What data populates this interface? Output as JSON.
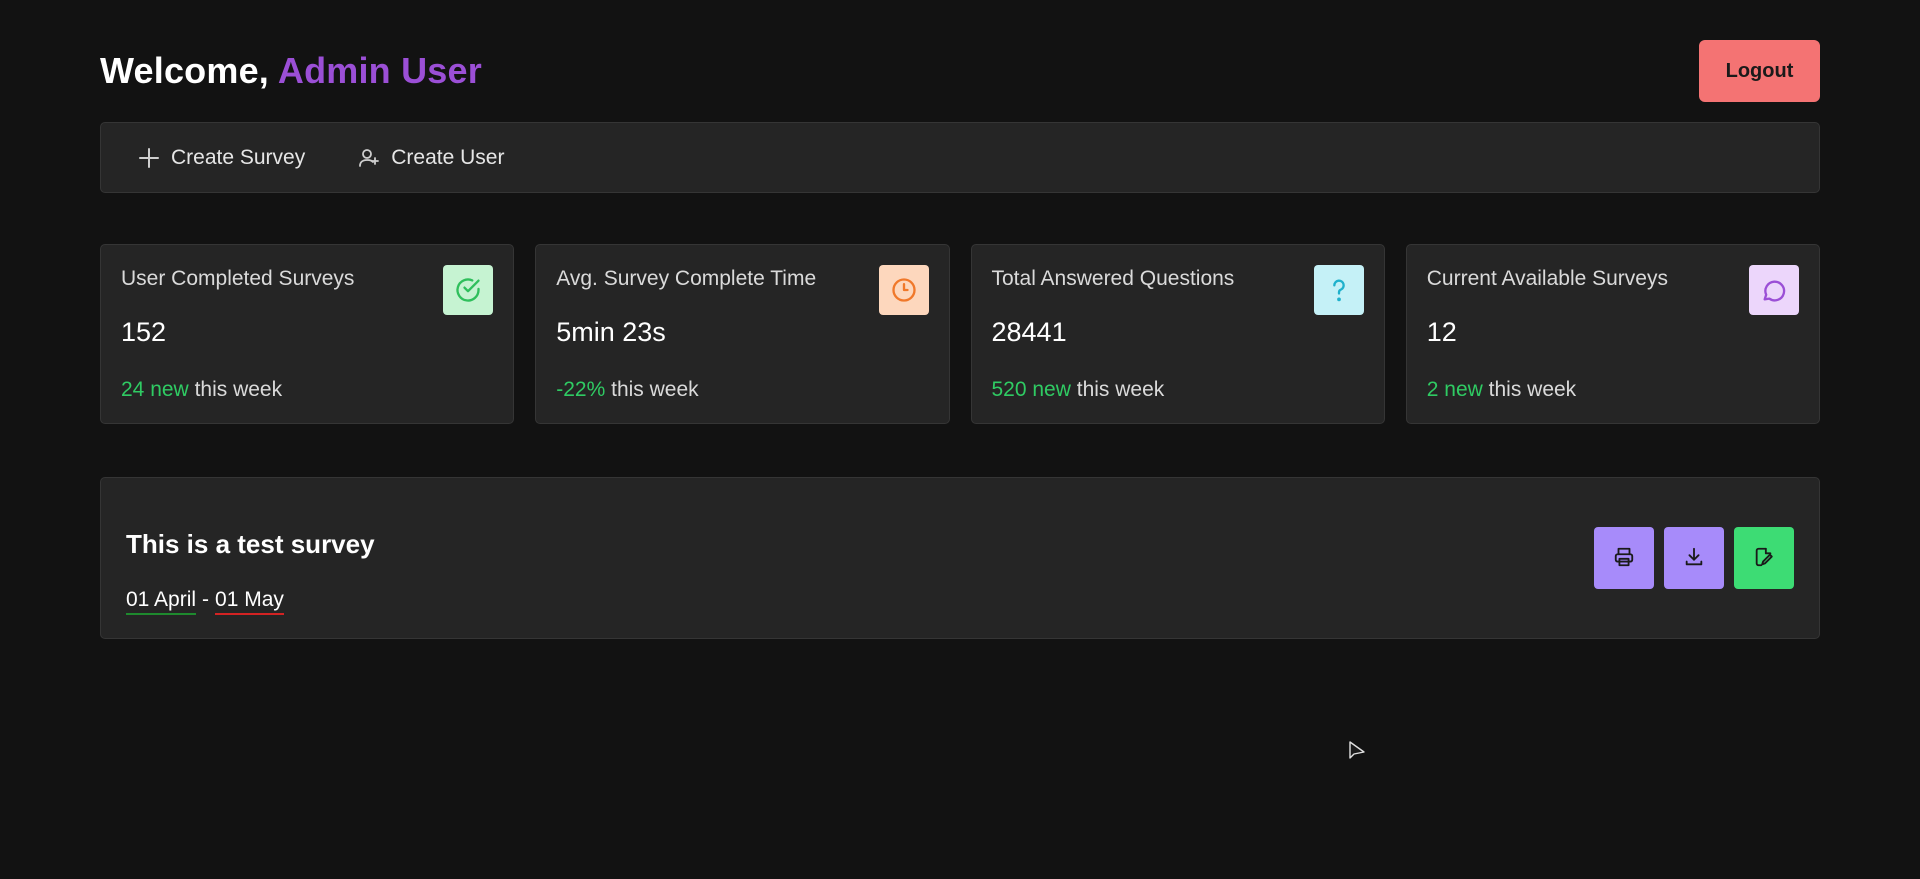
{
  "header": {
    "welcome_prefix": "Welcome,",
    "user_name": "Admin User",
    "logout_label": "Logout"
  },
  "actions": [
    {
      "label": "Create Survey",
      "icon": "plus-icon"
    },
    {
      "label": "Create User",
      "icon": "user-plus-icon"
    }
  ],
  "stats": [
    {
      "title": "User Completed Surveys",
      "value": "152",
      "delta": "24 new",
      "suffix": "this week",
      "icon": "check-circle-icon",
      "icon_bg": "#c6f3d2",
      "icon_color": "#2fbf5c"
    },
    {
      "title": "Avg. Survey Complete Time",
      "value": "5min 23s",
      "delta": "-22%",
      "suffix": "this week",
      "icon": "clock-icon",
      "icon_bg": "#fdd7bd",
      "icon_color": "#f0782a"
    },
    {
      "title": "Total Answered Questions",
      "value": "28441",
      "delta": "520 new",
      "suffix": "this week",
      "icon": "question-icon",
      "icon_bg": "#c5f1f7",
      "icon_color": "#1fb1cc"
    },
    {
      "title": "Current Available Surveys",
      "value": "12",
      "delta": "2 new",
      "suffix": "this week",
      "icon": "chat-bubble-icon",
      "icon_bg": "#ecd6fb",
      "icon_color": "#9b4fd6"
    }
  ],
  "survey": {
    "title": "This is a test survey",
    "start_date": "01 April",
    "separator": "-",
    "end_date": "01 May",
    "buttons": [
      {
        "icon": "printer-icon",
        "color": "#a78bfa"
      },
      {
        "icon": "download-icon",
        "color": "#a78bfa"
      },
      {
        "icon": "edit-icon",
        "color": "#3ddc74"
      }
    ]
  },
  "colors": {
    "background": "#121212",
    "panel": "#252525",
    "accent_purple": "#9b4fd6",
    "positive": "#2fcb63",
    "logout": "#f47373"
  }
}
